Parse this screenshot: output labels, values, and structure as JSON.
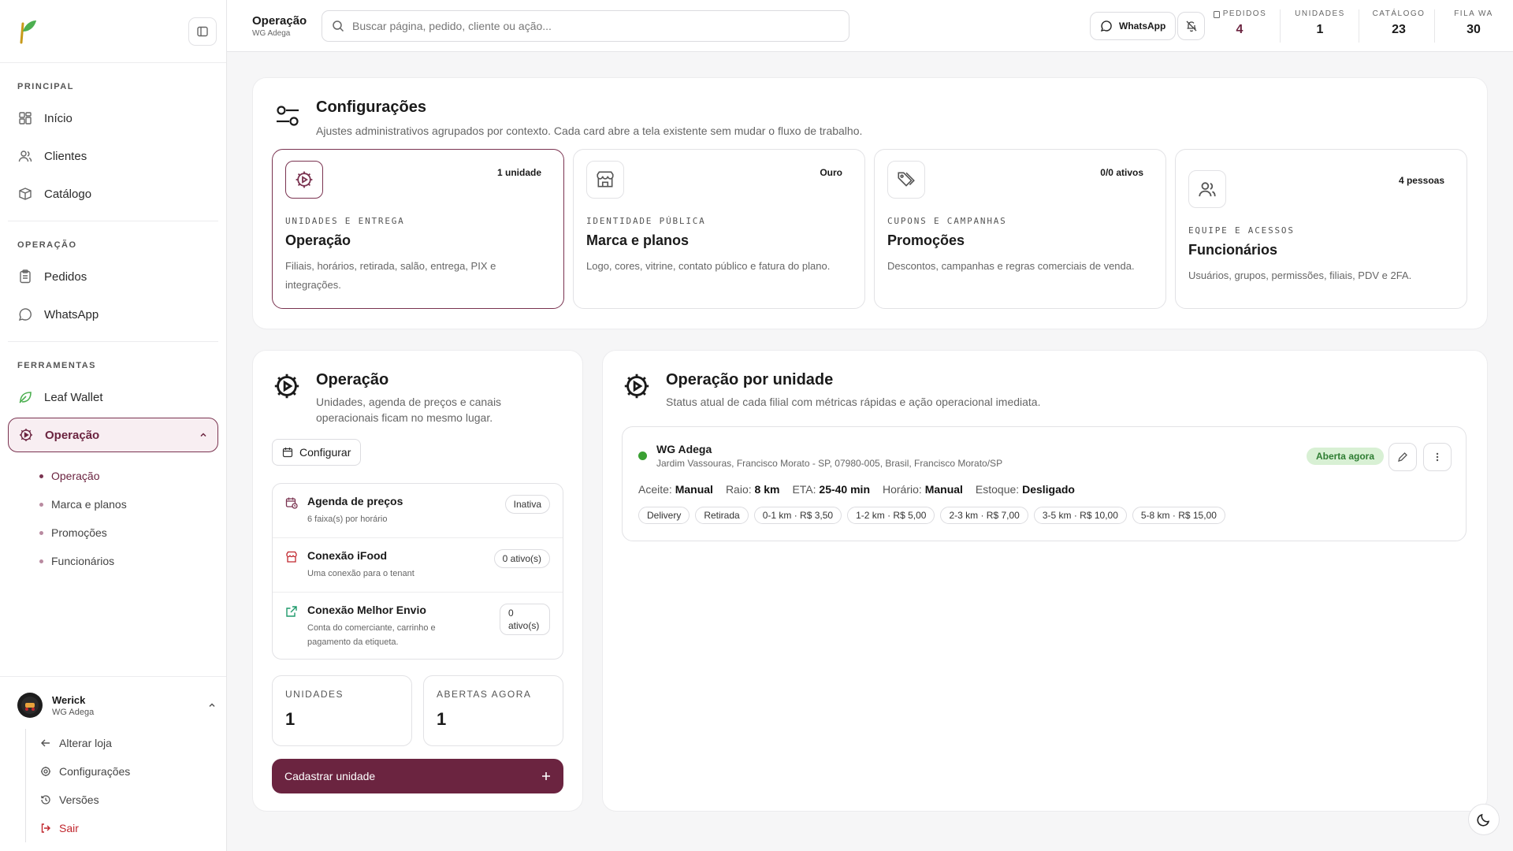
{
  "sidebar": {
    "sections": {
      "principal": "PRINCIPAL",
      "operacao": "OPERAÇÃO",
      "ferramentas": "FERRAMENTAS"
    },
    "items": {
      "inicio": "Início",
      "clientes": "Clientes",
      "catalogo": "Catálogo",
      "pedidos": "Pedidos",
      "whatsapp": "WhatsApp",
      "leaf_wallet": "Leaf Wallet",
      "operacao": "Operação"
    },
    "sub_items": [
      "Operação",
      "Marca e planos",
      "Promoções",
      "Funcionários"
    ],
    "user": {
      "name": "Werick",
      "store": "WG Adega",
      "menu": [
        "Alterar loja",
        "Configurações",
        "Versões",
        "Sair"
      ]
    }
  },
  "topbar": {
    "title": "Operação",
    "subtitle": "WG Adega",
    "search_placeholder": "Buscar página, pedido, cliente ou ação...",
    "whatsapp_label": "WhatsApp",
    "stats": [
      {
        "label": "PEDIDOS",
        "value": "4"
      },
      {
        "label": "UNIDADES",
        "value": "1"
      },
      {
        "label": "CATÁLOGO",
        "value": "23"
      },
      {
        "label": "FILA WA",
        "value": "30"
      }
    ]
  },
  "config": {
    "title": "Configurações",
    "subtitle": "Ajustes administrativos agrupados por contexto. Cada card abre a tela existente sem mudar o fluxo de trabalho.",
    "cards": [
      {
        "badge": "1 unidade",
        "eyebrow": "UNIDADES E ENTREGA",
        "title": "Operação",
        "desc": "Filiais, horários, retirada, salão, entrega, PIX e integrações."
      },
      {
        "badge": "Ouro",
        "eyebrow": "IDENTIDADE PÚBLICA",
        "title": "Marca e planos",
        "desc": "Logo, cores, vitrine, contato público e fatura do plano."
      },
      {
        "badge": "0/0 ativos",
        "eyebrow": "CUPONS E CAMPANHAS",
        "title": "Promoções",
        "desc": "Descontos, campanhas e regras comerciais de venda."
      },
      {
        "badge": "4 pessoas",
        "eyebrow": "EQUIPE E ACESSOS",
        "title": "Funcionários",
        "desc": "Usuários, grupos, permissões, filiais, PDV e 2FA."
      }
    ]
  },
  "operacao": {
    "title": "Operação",
    "subtitle": "Unidades, agenda de preços e canais operacionais ficam no mesmo lugar.",
    "configure_label": "Configurar",
    "list": [
      {
        "title": "Agenda de preços",
        "desc": "6 faixa(s) por horário",
        "badge": "Inativa"
      },
      {
        "title": "Conexão iFood",
        "desc": "Uma conexão para o tenant",
        "badge": "0 ativo(s)"
      },
      {
        "title": "Conexão Melhor Envio",
        "desc": "Conta do comerciante, carrinho e pagamento da etiqueta.",
        "badge": "0 ativo(s)"
      }
    ],
    "stats": [
      {
        "label": "UNIDADES",
        "value": "1"
      },
      {
        "label": "ABERTAS AGORA",
        "value": "1"
      }
    ],
    "cta_label": "Cadastrar unidade"
  },
  "por_unidade": {
    "title": "Operação por unidade",
    "subtitle": "Status atual de cada filial com métricas rápidas e ação operacional imediata.",
    "unit": {
      "name": "WG Adega",
      "address": "Jardim Vassouras, Francisco Morato - SP, 07980-005, Brasil, Francisco Morato/SP",
      "status": "Aberta agora",
      "metrics": [
        {
          "label": "Aceite:",
          "value": "Manual"
        },
        {
          "label": "Raio:",
          "value": "8 km"
        },
        {
          "label": "ETA:",
          "value": "25-40 min"
        },
        {
          "label": "Horário:",
          "value": "Manual"
        },
        {
          "label": "Estoque:",
          "value": "Desligado"
        }
      ],
      "tags": [
        "Delivery",
        "Retirada",
        "0-1 km · R$ 3,50",
        "1-2 km · R$ 5,00",
        "2-3 km · R$ 7,00",
        "3-5 km · R$ 10,00",
        "5-8 km · R$ 15,00"
      ]
    }
  },
  "colors": {
    "accent": "#6b2440",
    "success": "#3aa033",
    "danger": "#c0262d",
    "leaf": "#4caf50"
  }
}
